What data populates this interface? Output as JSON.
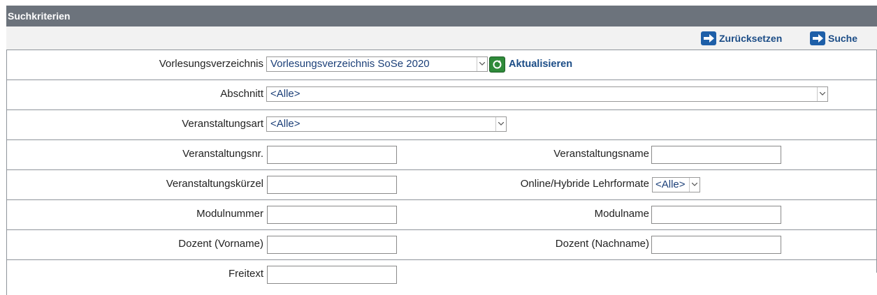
{
  "panel": {
    "title": "Suchkriterien"
  },
  "actions": {
    "reset_label": "Zurücksetzen",
    "search_label": "Suche"
  },
  "form": {
    "vorlesungsverzeichnis": {
      "label": "Vorlesungsverzeichnis",
      "value": "Vorlesungsverzeichnis SoSe 2020",
      "refresh_label": "Aktualisieren"
    },
    "abschnitt": {
      "label": "Abschnitt",
      "value": "<Alle>"
    },
    "veranstaltungsart": {
      "label": "Veranstaltungsart",
      "value": "<Alle>"
    },
    "veranstaltungsnr": {
      "label": "Veranstaltungsnr.",
      "value": ""
    },
    "veranstaltungsname": {
      "label": "Veranstaltungsname",
      "value": ""
    },
    "veranstaltungskuerzel": {
      "label": "Veranstaltungskürzel",
      "value": ""
    },
    "lehrformate": {
      "label": "Online/Hybride Lehrformate",
      "value": "<Alle>"
    },
    "modulnummer": {
      "label": "Modulnummer",
      "value": ""
    },
    "modulname": {
      "label": "Modulname",
      "value": ""
    },
    "dozent_vorname": {
      "label": "Dozent (Vorname)",
      "value": ""
    },
    "dozent_nachname": {
      "label": "Dozent (Nachname)",
      "value": ""
    },
    "freitext": {
      "label": "Freitext",
      "value": ""
    }
  },
  "colors": {
    "header": "#6c737c",
    "accent": "#1e5fa8",
    "link": "#1b4c86",
    "refresh": "#2f8a3a"
  }
}
